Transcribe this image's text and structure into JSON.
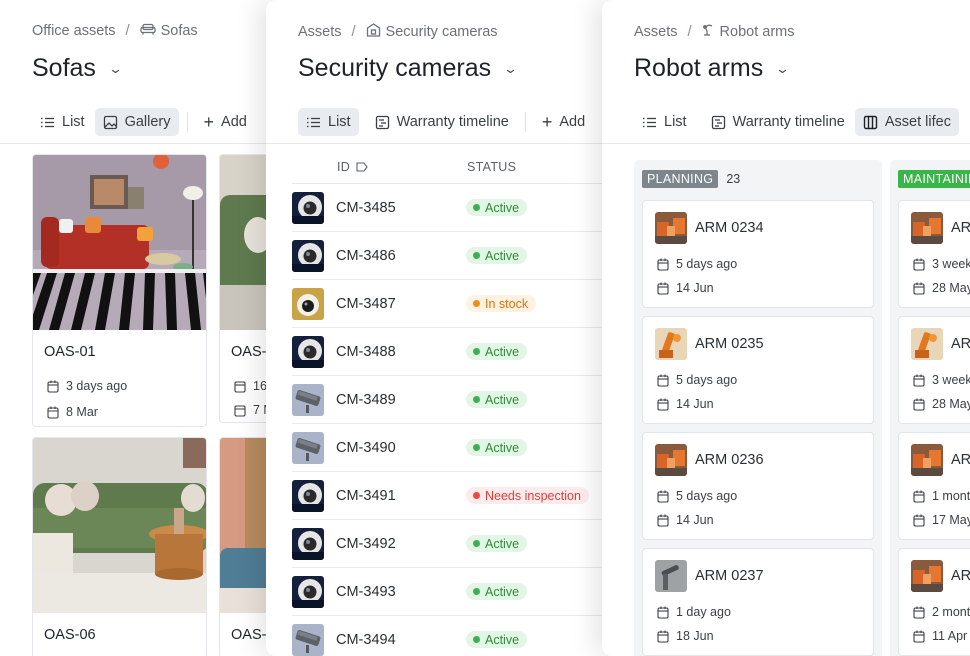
{
  "colors": {
    "active_bg": "#e3f6e5",
    "active_fg": "#2f8a3b",
    "active_dot": "#3db14e",
    "instock_bg": "#fff2e2",
    "instock_fg": "#d9730d",
    "instock_dot": "#f08c1a",
    "inspect_bg": "#fdeceb",
    "inspect_fg": "#d93f3a",
    "inspect_dot": "#ea4a44",
    "planning": "#7d858d",
    "maintaining": "#39b54a"
  },
  "panel1": {
    "breadcrumb_root": "Office assets",
    "breadcrumb_sep": "/",
    "breadcrumb_current": "Sofas",
    "breadcrumb_icon": "sofa-icon",
    "title": "Sofas",
    "tabs": [
      {
        "label": "List",
        "icon": "list-icon"
      },
      {
        "label": "Gallery",
        "icon": "gallery-icon"
      },
      {
        "label": "Add",
        "icon": "plus-icon"
      }
    ],
    "cards": [
      {
        "name": "OAS-01",
        "created": "3 days ago",
        "date": "8 Mar"
      },
      {
        "name": "OAS-",
        "created": "16",
        "date": "7 M"
      },
      {
        "name": "OAS-06",
        "created": "",
        "date": ""
      },
      {
        "name": "OAS-",
        "created": "",
        "date": ""
      }
    ]
  },
  "panel2": {
    "breadcrumb_root": "Assets",
    "breadcrumb_sep": "/",
    "breadcrumb_current": "Security cameras",
    "breadcrumb_icon": "building-icon",
    "title": "Security cameras",
    "tabs": [
      {
        "label": "List",
        "icon": "list-icon"
      },
      {
        "label": "Warranty timeline",
        "icon": "timeline-icon"
      },
      {
        "label": "Add",
        "icon": "plus-icon"
      }
    ],
    "columns": {
      "id": "ID",
      "status": "STATUS"
    },
    "rows": [
      {
        "id": "CM-3485",
        "status": "Active",
        "kind": "active",
        "cam": "dome"
      },
      {
        "id": "CM-3486",
        "status": "Active",
        "kind": "active",
        "cam": "dome"
      },
      {
        "id": "CM-3487",
        "status": "In stock",
        "kind": "instock",
        "cam": "gold"
      },
      {
        "id": "CM-3488",
        "status": "Active",
        "kind": "active",
        "cam": "dome"
      },
      {
        "id": "CM-3489",
        "status": "Active",
        "kind": "active",
        "cam": "bullet"
      },
      {
        "id": "CM-3490",
        "status": "Active",
        "kind": "active",
        "cam": "bullet"
      },
      {
        "id": "CM-3491",
        "status": "Needs inspection",
        "kind": "inspect",
        "cam": "dome"
      },
      {
        "id": "CM-3492",
        "status": "Active",
        "kind": "active",
        "cam": "dome"
      },
      {
        "id": "CM-3493",
        "status": "Active",
        "kind": "active",
        "cam": "dome"
      },
      {
        "id": "CM-3494",
        "status": "Active",
        "kind": "active",
        "cam": "bullet"
      }
    ]
  },
  "panel3": {
    "breadcrumb_root": "Assets",
    "breadcrumb_sep": "/",
    "breadcrumb_current": "Robot arms",
    "breadcrumb_icon": "robot-arm-icon",
    "title": "Robot arms",
    "tabs": [
      {
        "label": "List",
        "icon": "list-icon"
      },
      {
        "label": "Warranty timeline",
        "icon": "timeline-icon"
      },
      {
        "label": "Asset lifec",
        "icon": "board-icon"
      }
    ],
    "columns": [
      {
        "label": "PLANNING",
        "count": "23",
        "cards": [
          {
            "name": "ARM 0234",
            "created": "5 days ago",
            "date": "14 Jun",
            "img": "orange"
          },
          {
            "name": "ARM 0235",
            "created": "5 days ago",
            "date": "14 Jun",
            "img": "orange2"
          },
          {
            "name": "ARM 0236",
            "created": "5 days ago",
            "date": "14 Jun",
            "img": "orange"
          },
          {
            "name": "ARM 0237",
            "created": "1 day ago",
            "date": "18 Jun",
            "img": "grey"
          }
        ]
      },
      {
        "label": "MAINTAININ",
        "count": "",
        "cards": [
          {
            "name": "ARI",
            "created": "3 week",
            "date": "28 May",
            "img": "orange"
          },
          {
            "name": "ARI",
            "created": "3 week",
            "date": "28 May",
            "img": "orange2"
          },
          {
            "name": "ARI",
            "created": "1 month",
            "date": "17 May",
            "img": "orange"
          },
          {
            "name": "ARI",
            "created": "2 mont",
            "date": "11 Apr",
            "img": "orange"
          }
        ]
      }
    ]
  }
}
